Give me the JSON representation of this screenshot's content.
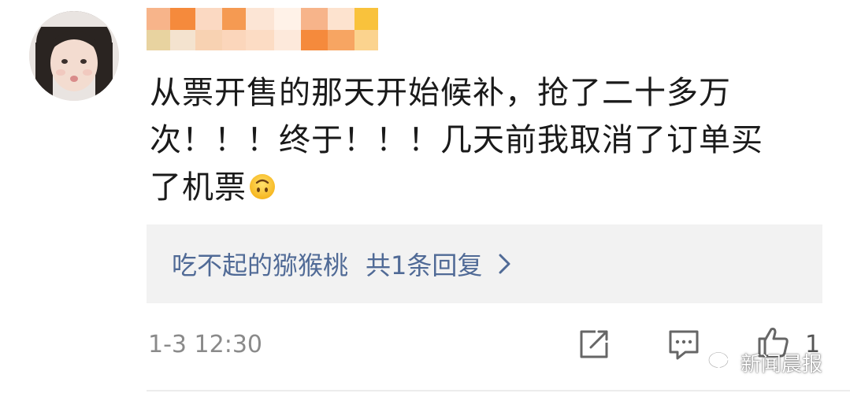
{
  "comment": {
    "line1": "从票开售的那天开始候补，抢了二十多万",
    "line2": "次！！！终于！！！几天前我取消了订单买",
    "line3": "了机票",
    "emoji_name": "upside-down-face-emoji"
  },
  "reply": {
    "author": "吃不起的猕猴桃",
    "count_text": "共1条回复"
  },
  "footer": {
    "timestamp": "1-3 12:30",
    "like_count": "1"
  },
  "watermark": {
    "text": "新闻晨报",
    "icon": "wechat-icon"
  },
  "icons": {
    "share": "share-icon",
    "comment": "comment-icon",
    "like": "thumbs-up-icon",
    "chevron": "chevron-right-icon"
  },
  "colors": {
    "reply_link": "#506a96",
    "reply_bg": "#f2f2f2",
    "text": "#1a1a1a",
    "muted": "#8a8a8a"
  }
}
